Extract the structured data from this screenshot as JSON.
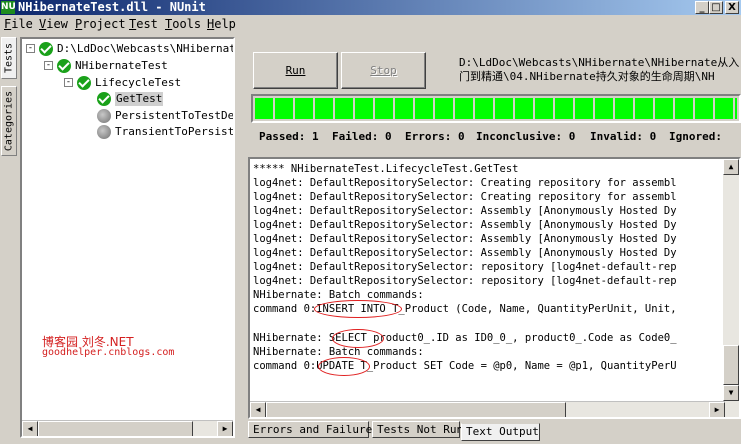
{
  "window": {
    "title": "NHibernateTest.dll - NUnit",
    "icon_text": "NU",
    "min_glyph": "_",
    "max_glyph": "□",
    "close_glyph": "X"
  },
  "menu": [
    {
      "label": "File",
      "ul": "F",
      "rest": "ile"
    },
    {
      "label": "View",
      "ul": "V",
      "rest": "iew"
    },
    {
      "label": "Project",
      "ul": "P",
      "rest": "roject"
    },
    {
      "label": "Test",
      "ul": "T",
      "rest": "est"
    },
    {
      "label": "Tools",
      "ul": "T",
      "rest": "ools"
    },
    {
      "label": "Help",
      "ul": "H",
      "rest": "elp"
    }
  ],
  "side_tabs": {
    "tests": "Tests",
    "categories": "Categories"
  },
  "tree": [
    {
      "label": "D:\\LdDoc\\Webcasts\\NHibernate\\",
      "status": "pass",
      "expander": "-"
    },
    {
      "label": "NHibernateTest",
      "status": "pass",
      "expander": "-"
    },
    {
      "label": "LifecycleTest",
      "status": "pass",
      "expander": "-"
    },
    {
      "label": "GetTest",
      "status": "pass",
      "selected": true
    },
    {
      "label": "PersistentToTestDet",
      "status": "notrun"
    },
    {
      "label": "TransientToPersiste",
      "status": "notrun"
    }
  ],
  "watermark": {
    "line1": "博客园  刘冬.NET",
    "line2": "goodhelper.cnblogs.com"
  },
  "buttons": {
    "run": "Run",
    "stop": "Stop"
  },
  "path": {
    "line1": "D:\\LdDoc\\Webcasts\\NHibernate\\NHibernate从入",
    "line2": "门到精通\\04.NHibernate持久对象的生命周期\\NH"
  },
  "progress": {
    "percent": 100,
    "color": "#00ff00"
  },
  "summary": {
    "passed": "Passed: 1",
    "failed": "Failed: 0",
    "errors": "Errors: 0",
    "inconclusive": "Inconclusive: 0",
    "invalid": "Invalid: 0",
    "ignored": "Ignored:"
  },
  "output_lines": [
    "***** NHibernateTest.LifecycleTest.GetTest",
    "log4net: DefaultRepositorySelector: Creating repository for assembl",
    "log4net: DefaultRepositorySelector: Creating repository for assembl",
    "log4net: DefaultRepositorySelector: Assembly [Anonymously Hosted Dy",
    "log4net: DefaultRepositorySelector: Assembly [Anonymously Hosted Dy",
    "log4net: DefaultRepositorySelector: Assembly [Anonymously Hosted Dy",
    "log4net: DefaultRepositorySelector: Assembly [Anonymously Hosted Dy",
    "log4net: DefaultRepositorySelector: repository [log4net-default-rep",
    "log4net: DefaultRepositorySelector: repository [log4net-default-rep",
    "NHibernate: Batch commands:",
    "command 0:INSERT INTO T_Product (Code, Name, QuantityPerUnit, Unit,",
    "",
    "NHibernate: SELECT product0_.ID as ID0_0_, product0_.Code as Code0_",
    "NHibernate: Batch commands:",
    "command 0:UPDATE T_Product SET Code = @p0, Name = @p1, QuantityPerU"
  ],
  "bottom_tabs": [
    "Errors and Failures",
    "Tests Not Run",
    "Text Output"
  ]
}
